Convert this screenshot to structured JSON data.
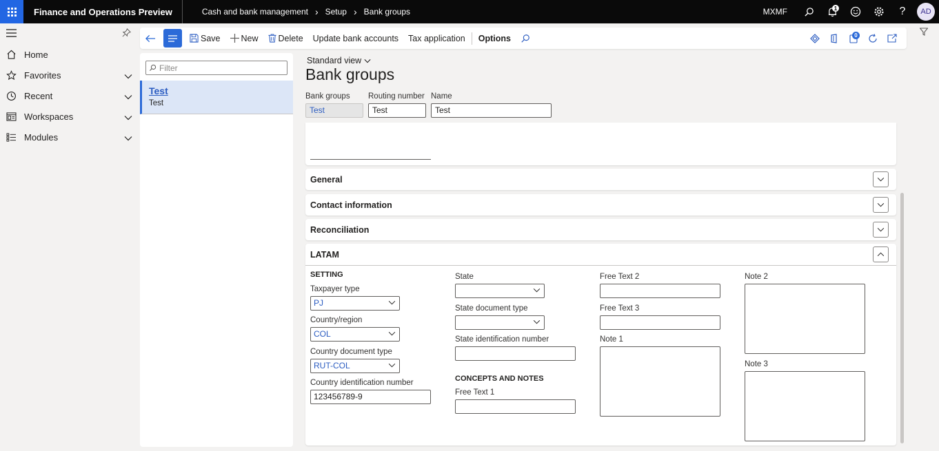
{
  "topbar": {
    "app_title": "Finance and Operations Preview",
    "breadcrumbs": [
      "Cash and bank management",
      "Setup",
      "Bank groups"
    ],
    "company": "MXMF",
    "notification_count": "1",
    "avatar_initials": "AD"
  },
  "nav": {
    "items": [
      {
        "label": "Home"
      },
      {
        "label": "Favorites"
      },
      {
        "label": "Recent"
      },
      {
        "label": "Workspaces"
      },
      {
        "label": "Modules"
      }
    ]
  },
  "actions": {
    "save": "Save",
    "new": "New",
    "delete": "Delete",
    "update_bank_accounts": "Update bank accounts",
    "tax_application": "Tax application",
    "options": "Options",
    "attachments_count": "0"
  },
  "list": {
    "filter_placeholder": "Filter",
    "rows": [
      {
        "title": "Test",
        "subtitle": "Test"
      }
    ]
  },
  "detail": {
    "view": "Standard view",
    "title": "Bank groups",
    "header_fields": {
      "bank_groups_label": "Bank groups",
      "bank_groups_value": "Test",
      "routing_label": "Routing number",
      "routing_value": "Test",
      "name_label": "Name",
      "name_value": "Test"
    },
    "fasttabs": [
      "General",
      "Contact information",
      "Reconciliation"
    ],
    "latam": {
      "title": "LATAM",
      "setting_title": "SETTING",
      "taxpayer_type_label": "Taxpayer type",
      "taxpayer_type_value": "PJ",
      "country_label": "Country/region",
      "country_value": "COL",
      "country_doc_label": "Country document type",
      "country_doc_value": "RUT-COL",
      "country_id_label": "Country identification number",
      "country_id_value": "123456789-9",
      "state_label": "State",
      "state_doc_label": "State document type",
      "state_id_label": "State identification number",
      "concepts_title": "CONCEPTS AND NOTES",
      "free_text1_label": "Free Text 1",
      "free_text2_label": "Free Text 2",
      "free_text3_label": "Free Text 3",
      "note1_label": "Note 1",
      "note2_label": "Note 2",
      "note3_label": "Note 3"
    }
  }
}
